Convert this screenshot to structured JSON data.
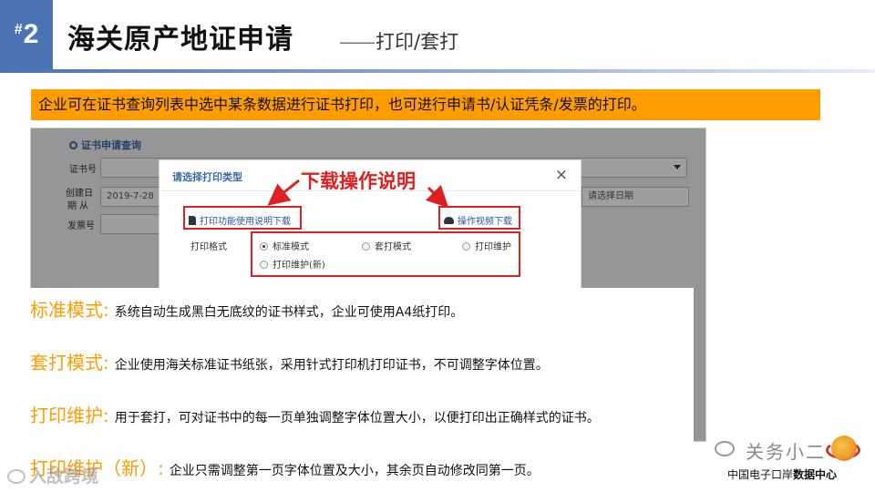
{
  "header": {
    "number_hash": "#",
    "number": "2",
    "title": "海关原产地证申请",
    "subtitle_dash": "——",
    "subtitle": "打印/套打"
  },
  "intro": "企业可在证书查询列表中选中某条数据进行证书打印，也可进行申请书/认证凭条/发票的打印。",
  "screenshot": {
    "panel_title": "证书申请查询",
    "fields": [
      {
        "label": "证书号",
        "value": ""
      },
      {
        "label_line1": "创建日",
        "label_line2": "期 从",
        "value": "2019-7-28",
        "placeholder_right": "请选择日期"
      },
      {
        "label": "发票号",
        "value": ""
      }
    ],
    "dialog": {
      "title": "请选择打印类型",
      "close": "×",
      "manual_download": "打印功能使用说明下载",
      "video_download": "操作视频下载",
      "format_label": "打印格式",
      "options": [
        {
          "label": "标准模式",
          "selected": true
        },
        {
          "label": "套打模式",
          "selected": false
        },
        {
          "label": "打印维护",
          "selected": false
        },
        {
          "label": "打印维护(新)",
          "selected": false
        }
      ]
    },
    "callout": "下载操作说明"
  },
  "descriptions": [
    {
      "term": "标准模式:",
      "text": "系统自动生成黑白无底纹的证书样式，企业可使用A4纸打印。"
    },
    {
      "term": "套打模式:",
      "text": "企业使用海关标准证书纸张，采用针式打印机打印证书，不可调整字体位置。"
    },
    {
      "term": "打印维护:",
      "text": "用于套打，可对证书中的每一页单独调整字体位置大小，以便打印出正确样式的证书。"
    },
    {
      "term": "打印维护（新）:",
      "text": "企业只需调整第一页字体位置及大小，其余页自动修改同第一页。"
    }
  ],
  "watermark_left": "入敌跨境",
  "brand": {
    "name": "关务小二",
    "sub_plain": "中国电子口岸",
    "sub_bold": "数据中心"
  },
  "colors": {
    "accent_blue": "#4b74b5",
    "highlight_orange": "#ff9c00",
    "callout_red": "#e02020"
  }
}
